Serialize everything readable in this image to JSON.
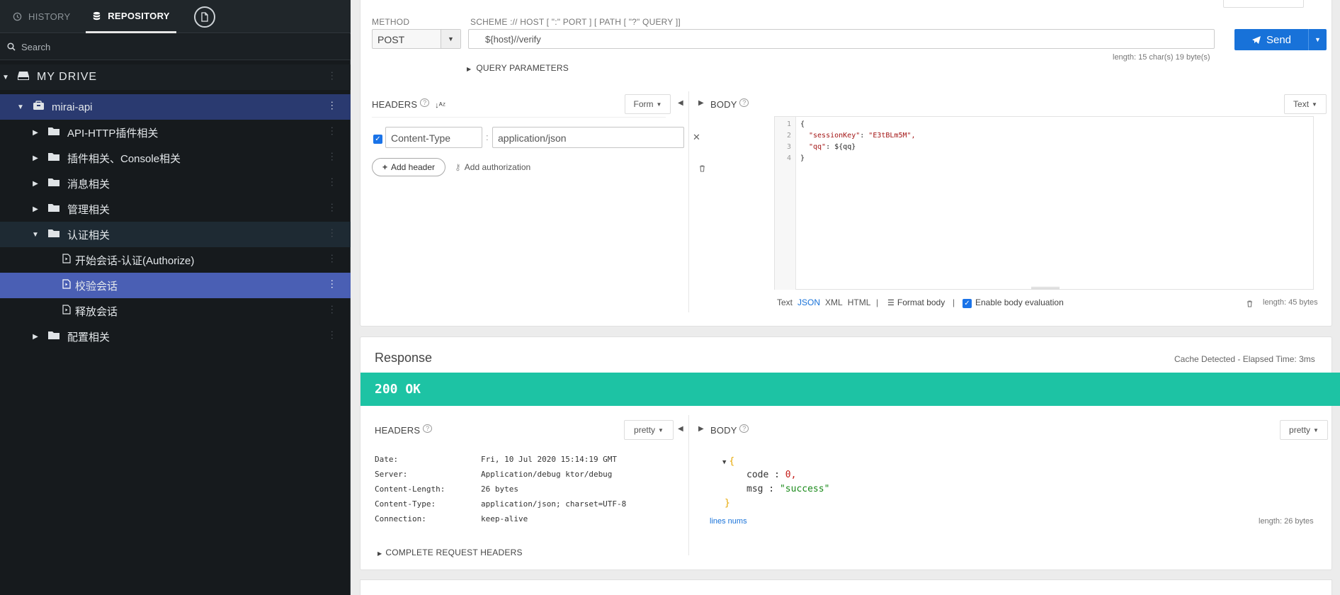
{
  "sidebar": {
    "tabs": {
      "history": "HISTORY",
      "repository": "REPOSITORY"
    },
    "search_placeholder": "Search",
    "drive": "MY DRIVE",
    "project": "mirai-api",
    "folders": [
      {
        "label": "API-HTTP插件相关"
      },
      {
        "label": "插件相关、Console相关"
      },
      {
        "label": "消息相关"
      },
      {
        "label": "管理相关"
      },
      {
        "label": "认证相关"
      }
    ],
    "requests": [
      {
        "label": "开始会话-认证(Authorize)"
      },
      {
        "label": "校验会话"
      },
      {
        "label": "释放会话"
      }
    ],
    "folder_last": "配置相关"
  },
  "request": {
    "method_label": "METHOD",
    "method": "POST",
    "scheme_label": "SCHEME :// HOST [ \":\" PORT ] [ PATH [ \"?\" QUERY ]]",
    "url": "${host}//verify",
    "send": "Send",
    "url_length": "length: 15 char(s) 19 byte(s)",
    "query_params": "QUERY PARAMETERS",
    "headers_label": "HEADERS",
    "headers_mode": "Form",
    "header_name": "Content-Type",
    "header_value": "application/json",
    "add_header": "Add header",
    "add_authorization": "Add authorization",
    "body_label": "BODY",
    "body_mode": "Text",
    "body_lines": [
      "1",
      "2",
      "3",
      "4"
    ],
    "body_code": {
      "l1": "{",
      "l2_key": "\"sessionKey\"",
      "l2_val": "\"E3tBLm5M\",",
      "l3_key": "\"qq\"",
      "l3_val": "${qq}",
      "l4": "}"
    },
    "body_formats": {
      "text": "Text",
      "json": "JSON",
      "xml": "XML",
      "html": "HTML"
    },
    "format_body": "Format body",
    "enable_eval": "Enable body evaluation",
    "body_length": "length: 45 bytes"
  },
  "response": {
    "title": "Response",
    "cache": "Cache Detected - Elapsed Time: 3ms",
    "status": "200 OK",
    "headers_label": "HEADERS",
    "headers_mode": "pretty",
    "headers": [
      {
        "k": "Date:",
        "v": "Fri, 10 Jul 2020 15:14:19 GMT"
      },
      {
        "k": "Server:",
        "v": "Application/debug ktor/debug"
      },
      {
        "k": "Content-Length:",
        "v": "26 bytes"
      },
      {
        "k": "Content-Type:",
        "v": "application/json; charset=UTF-8"
      },
      {
        "k": "Connection:",
        "v": "keep-alive"
      }
    ],
    "complete_headers": "COMPLETE REQUEST HEADERS",
    "body_label": "BODY",
    "body_mode": "pretty",
    "json": {
      "open": "{",
      "code_key": "code",
      "code_val": "0,",
      "msg_key": "msg",
      "msg_val": "\"success\"",
      "close": "}"
    },
    "lines_nums": "lines nums",
    "body_length": "length: 26 bytes"
  },
  "colors": {
    "accent": "#1872d9",
    "status_ok": "#1dc3a4",
    "sidebar_bg": "#161a1d",
    "selected": "#4a5fb4"
  }
}
